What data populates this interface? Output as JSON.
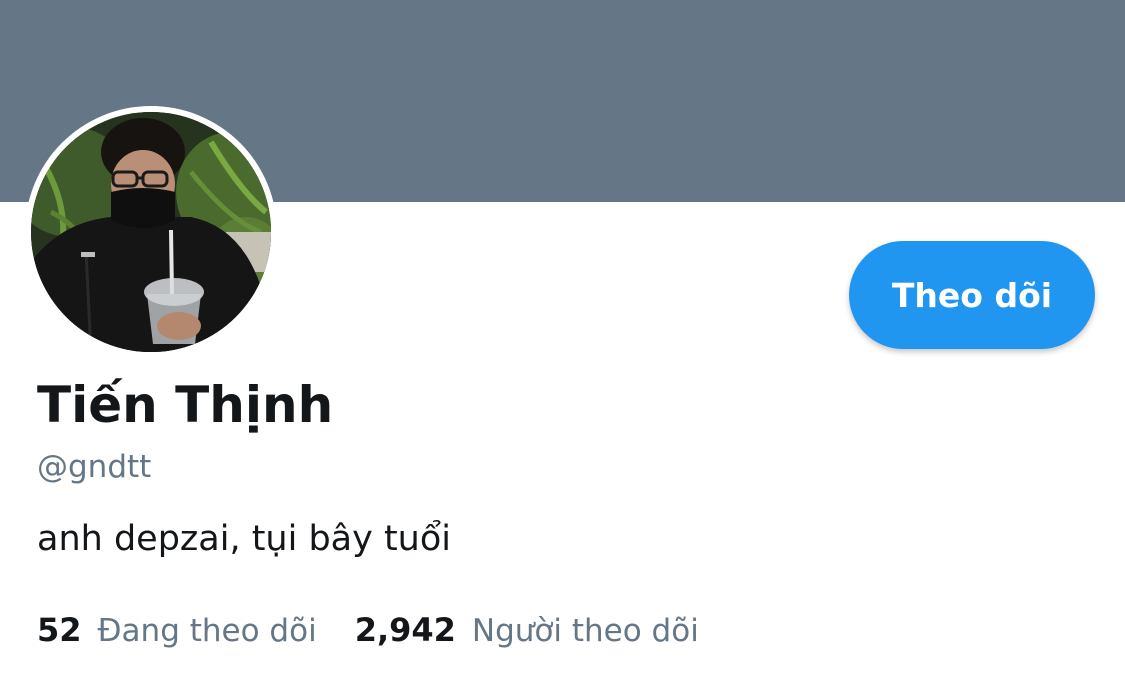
{
  "profile": {
    "display_name": "Tiến Thịnh",
    "handle": "@gndtt",
    "bio": "anh depzai, tụi bây tuổi"
  },
  "actions": {
    "follow_label": "Theo dõi"
  },
  "stats": {
    "following_count": "52",
    "following_label": "Đang theo dõi",
    "followers_count": "2,942",
    "followers_label": "Người theo dõi"
  },
  "colors": {
    "banner": "#657786",
    "accent": "#2196f0",
    "primary_text": "#14171a",
    "secondary_text": "#657786"
  }
}
